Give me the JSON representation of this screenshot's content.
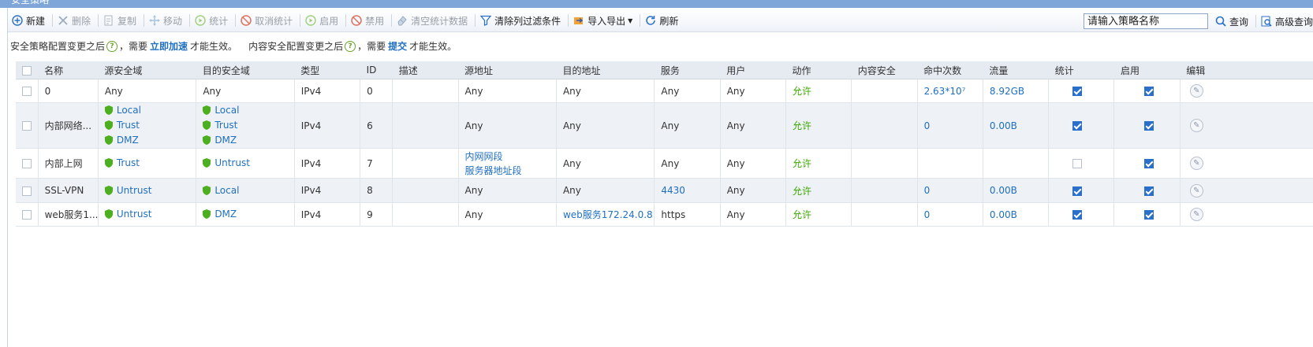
{
  "window": {
    "title": "安全策略"
  },
  "toolbar": {
    "buttons": [
      {
        "label": "新建",
        "icon": "plus-circle-icon",
        "enabled": true
      },
      {
        "label": "删除",
        "icon": "x-icon",
        "enabled": false
      },
      {
        "label": "复制",
        "icon": "copy-icon",
        "enabled": false
      },
      {
        "label": "移动",
        "icon": "move-icon",
        "enabled": false
      },
      {
        "label": "统计",
        "icon": "play-circle-icon",
        "enabled": false
      },
      {
        "label": "取消统计",
        "icon": "ban-icon",
        "enabled": false
      },
      {
        "label": "启用",
        "icon": "play-circle-icon",
        "enabled": false
      },
      {
        "label": "禁用",
        "icon": "ban-icon",
        "enabled": false
      },
      {
        "label": "清空统计数据",
        "icon": "eraser-icon",
        "enabled": false
      },
      {
        "label": "清除列过滤条件",
        "icon": "filter-icon",
        "enabled": true
      },
      {
        "label": "导入导出",
        "icon": "import-export-icon",
        "enabled": true,
        "dropdown": true
      },
      {
        "label": "刷新",
        "icon": "refresh-icon",
        "enabled": true
      }
    ],
    "search": {
      "placeholder": "请输入策略名称",
      "value": ""
    },
    "query_label": "查询",
    "advanced_label": "高级查询"
  },
  "notice": {
    "part1": "安全策略配置变更之后",
    "part2": "，需要",
    "link1": "立即加速",
    "part3": "才能生效。",
    "part4": "内容安全配置变更之后",
    "part5": "，需要",
    "link2": "提交",
    "part6": "才能生效。"
  },
  "table": {
    "columns": [
      "名称",
      "源安全域",
      "目的安全域",
      "类型",
      "ID",
      "描述",
      "源地址",
      "目的地址",
      "服务",
      "用户",
      "动作",
      "内容安全",
      "命中次数",
      "流量",
      "统计",
      "启用",
      "编辑"
    ],
    "rows": [
      {
        "name": "0",
        "src_zone": [
          "Any"
        ],
        "dst_zone": [
          "Any"
        ],
        "type": "IPv4",
        "id": "0",
        "desc": "",
        "src_addr": [
          "Any"
        ],
        "dst_addr": [
          "Any"
        ],
        "service": "Any",
        "user": "Any",
        "action": "允许",
        "content": "",
        "hits": "2.63*10⁷",
        "traffic": "8.92GB",
        "stat": true,
        "enabled": true
      },
      {
        "name": "内部网络...",
        "src_zone": [
          "Local",
          "Trust",
          "DMZ"
        ],
        "dst_zone": [
          "Local",
          "Trust",
          "DMZ"
        ],
        "type": "IPv4",
        "id": "6",
        "desc": "",
        "src_addr": [
          "Any"
        ],
        "dst_addr": [
          "Any"
        ],
        "service": "Any",
        "user": "Any",
        "action": "允许",
        "content": "",
        "hits": "0",
        "traffic": "0.00B",
        "stat": true,
        "enabled": true
      },
      {
        "name": "内部上网",
        "src_zone": [
          "Trust"
        ],
        "dst_zone": [
          "Untrust"
        ],
        "type": "IPv4",
        "id": "7",
        "desc": "",
        "src_addr": [
          "内网网段",
          "服务器地址段"
        ],
        "dst_addr": [
          "Any"
        ],
        "service": "Any",
        "user": "Any",
        "action": "允许",
        "content": "",
        "hits": "",
        "traffic": "",
        "stat": false,
        "enabled": true
      },
      {
        "name": "SSL-VPN",
        "src_zone": [
          "Untrust"
        ],
        "dst_zone": [
          "Local"
        ],
        "type": "IPv4",
        "id": "8",
        "desc": "",
        "src_addr": [
          "Any"
        ],
        "dst_addr": [
          "Any"
        ],
        "service": "4430",
        "user": "Any",
        "action": "允许",
        "content": "",
        "hits": "0",
        "traffic": "0.00B",
        "stat": true,
        "enabled": true
      },
      {
        "name": "web服务1...",
        "src_zone": [
          "Untrust"
        ],
        "dst_zone": [
          "DMZ"
        ],
        "type": "IPv4",
        "id": "9",
        "desc": "",
        "src_addr": [
          "Any"
        ],
        "dst_addr": [
          "web服务172.24.0.8"
        ],
        "service": "https",
        "user": "Any",
        "action": "允许",
        "content": "",
        "hits": "0",
        "traffic": "0.00B",
        "stat": true,
        "enabled": true
      }
    ]
  },
  "colors": {
    "accent": "#1f6fc2",
    "allow": "#3aa800",
    "header_bg": "#e6ebf2",
    "title_bar": "#7ea6d8",
    "shield": "#4caf1e"
  }
}
